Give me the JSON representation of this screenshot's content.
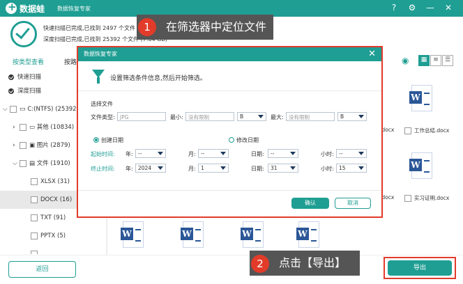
{
  "app": {
    "brand": "数据蛙",
    "subtitle": "数据恢复专家",
    "controls": [
      "?",
      "⚙",
      "—",
      "✕"
    ]
  },
  "status": {
    "quick": "快速扫描已完成,已找到 2497 个文件",
    "deep": "深度扫描已完成,已找到 25392 个文件 (7.64 GB)"
  },
  "tabs": {
    "by_type": "按类型查看",
    "by_path": "按路"
  },
  "sidebar": {
    "quick_scan": "快速扫描",
    "deep_scan": "深度扫描",
    "drive": "C:(NTFS) (25392)",
    "other": "其他 (10834)",
    "pictures": "图片 (2879)",
    "docs": "文件 (1910)",
    "xlsx": "XLSX (31)",
    "docx": "DOCX (16)",
    "txt": "TXT (91)",
    "pptx": "PPTX (5)"
  },
  "files": {
    "label1": ".docx",
    "label2": "工作总结.docx",
    "label3": ".docx",
    "label4": "实习证明.docx"
  },
  "footer": {
    "back": "返回",
    "export": "导出"
  },
  "callouts": {
    "step1_num": "1",
    "step1": "在筛选器中定位文件",
    "step2_num": "2",
    "step2": "点击【导出】"
  },
  "dialog": {
    "title": "数据恢复专家",
    "close": "✕",
    "intro": "设置筛选条件信息,然后开始筛选。",
    "section": "选择文件",
    "file_type_label": "文件类型:",
    "file_type_placeholder": "JPG",
    "min_label": "最小:",
    "min_placeholder": "没有限制",
    "min_unit": "B",
    "max_label": "最大:",
    "max_placeholder": "没有限制",
    "max_unit": "B",
    "created": "创建日期",
    "modified": "修改日期",
    "start_label": "起始时间:",
    "end_label": "终止时间:",
    "year": "年:",
    "month": "月:",
    "day": "日期:",
    "hour": "小时:",
    "start": {
      "year": "--",
      "month": "--",
      "day": "--",
      "hour": "--"
    },
    "end": {
      "year": "2024",
      "month": "1",
      "day": "31",
      "hour": "15"
    },
    "ok": "确认",
    "cancel": "取消"
  },
  "colors": {
    "accent": "#1f9e93",
    "highlight": "#e23b2a",
    "word_blue": "#2b5797"
  }
}
